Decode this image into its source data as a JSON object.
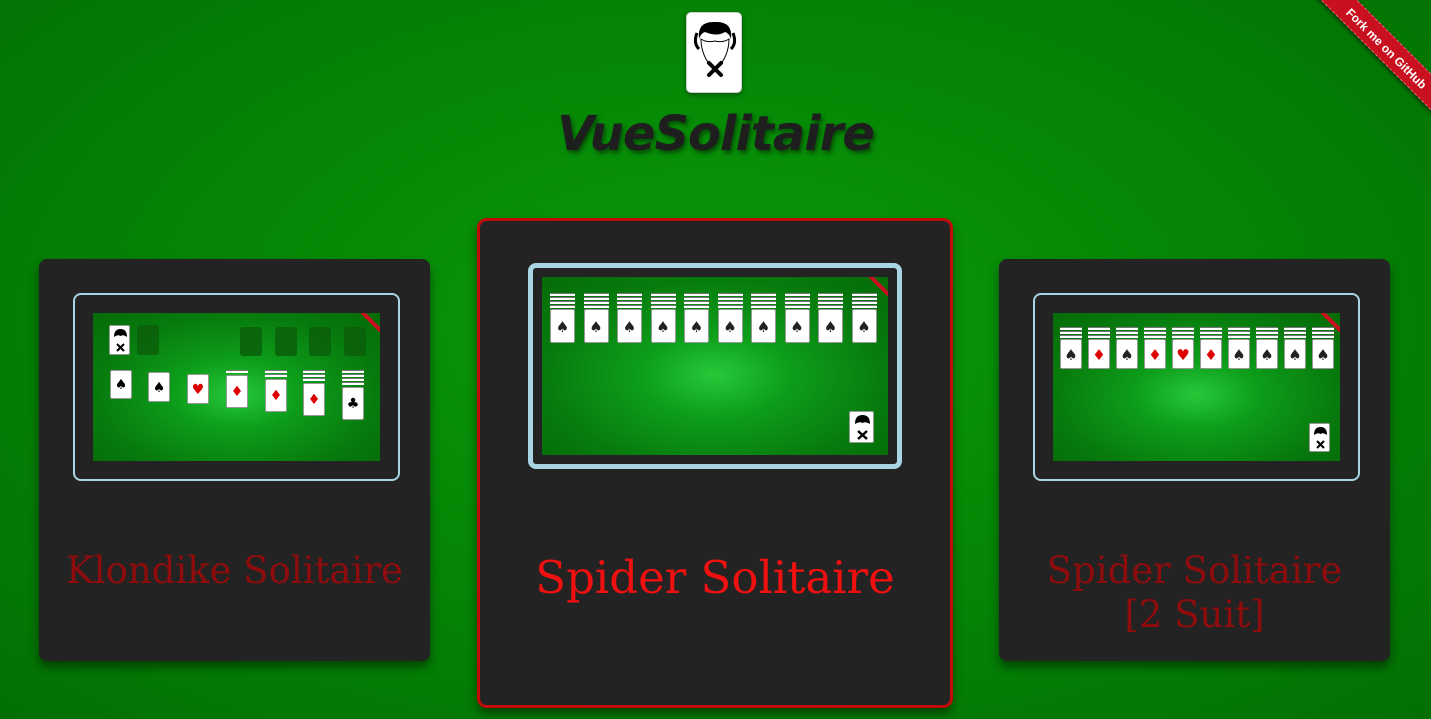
{
  "app": {
    "title": "VueSolitaire",
    "ribbon_label": "Fork me on GitHub"
  },
  "games": [
    {
      "title": "Klondike Solitaire",
      "active": false
    },
    {
      "title": "Spider Solitaire",
      "active": true
    },
    {
      "title": "Spider Solitaire [2 Suit]",
      "active": false
    }
  ],
  "colors": {
    "felt": "#0a8f0a",
    "panel": "#232323",
    "active_border": "#c20a0a",
    "active_title": "#f01010",
    "inactive_title": "#8e0c0c",
    "preview_border": "#a9d4e4"
  },
  "icons": {
    "logo": "joker-face-card-icon",
    "deal": "joker-face-card-icon"
  }
}
